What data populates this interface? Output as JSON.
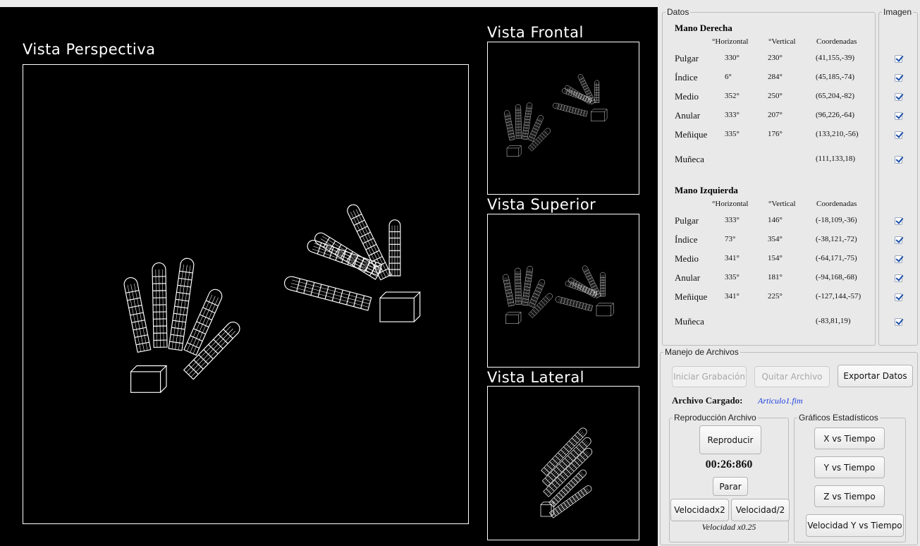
{
  "views": {
    "perspective": "Vista Perspectiva",
    "frontal": "Vista Frontal",
    "superior": "Vista Superior",
    "lateral": "Vista Lateral"
  },
  "datos": {
    "legend": "Datos",
    "imagen_legend": "Imagen",
    "col_horizontal": "°Horizontal",
    "col_vertical": "°Vertical",
    "col_coord": "Coordenadas",
    "right_hand": {
      "title": "Mano Derecha",
      "rows": [
        {
          "label": "Pulgar",
          "h": "330°",
          "v": "230°",
          "c": "(41,155,-39)",
          "checked": true
        },
        {
          "label": "Índice",
          "h": "6°",
          "v": "284°",
          "c": "(45,185,-74)",
          "checked": true
        },
        {
          "label": "Medio",
          "h": "352°",
          "v": "250°",
          "c": "(65,204,-82)",
          "checked": true
        },
        {
          "label": "Anular",
          "h": "333°",
          "v": "207°",
          "c": "(96,226,-64)",
          "checked": true
        },
        {
          "label": "Meñique",
          "h": "335°",
          "v": "176°",
          "c": "(133,210,-56)",
          "checked": true
        },
        {
          "label": "Muñeca",
          "h": "",
          "v": "",
          "c": "(111,133,18)",
          "checked": true
        }
      ]
    },
    "left_hand": {
      "title": "Mano Izquierda",
      "rows": [
        {
          "label": "Pulgar",
          "h": "333°",
          "v": "146°",
          "c": "(-18,109,-36)",
          "checked": true
        },
        {
          "label": "Índice",
          "h": "73°",
          "v": "354°",
          "c": "(-38,121,-72)",
          "checked": true
        },
        {
          "label": "Medio",
          "h": "341°",
          "v": "154°",
          "c": "(-64,171,-75)",
          "checked": true
        },
        {
          "label": "Anular",
          "h": "335°",
          "v": "181°",
          "c": "(-94,168,-68)",
          "checked": true
        },
        {
          "label": "Meñique",
          "h": "341°",
          "v": "225°",
          "c": "(-127,144,-57)",
          "checked": true
        },
        {
          "label": "Muñeca",
          "h": "",
          "v": "",
          "c": "(-83,81,19)",
          "checked": true
        }
      ]
    }
  },
  "archivos": {
    "legend": "Manejo de Archivos",
    "btn_iniciar": "Iniciar Grabación",
    "btn_quitar": "Quitar Archivo",
    "btn_exportar": "Exportar Datos",
    "cargado_label": "Archivo Cargado:",
    "cargado_value": "Articulo1.fim"
  },
  "reproduccion": {
    "legend": "Reproducción Archivo",
    "btn_reproducir": "Reproducir",
    "time": "00:26:860",
    "btn_parar": "Parar",
    "btn_vel_x2": "Velocidadx2",
    "btn_vel_half": "Velocidad/2",
    "speed": "Velocidad x0.25"
  },
  "graficos": {
    "legend": "Gráficos Estadísticos",
    "btn_x": "X vs Tiempo",
    "btn_y": "Y vs Tiempo",
    "btn_z": "Z vs Tiempo",
    "btn_vel_y": "Velocidad Y vs Tiempo"
  },
  "colors": {
    "link_blue": "#2040e0",
    "check_blue": "#1c4ea8",
    "canvas": "#000000"
  }
}
